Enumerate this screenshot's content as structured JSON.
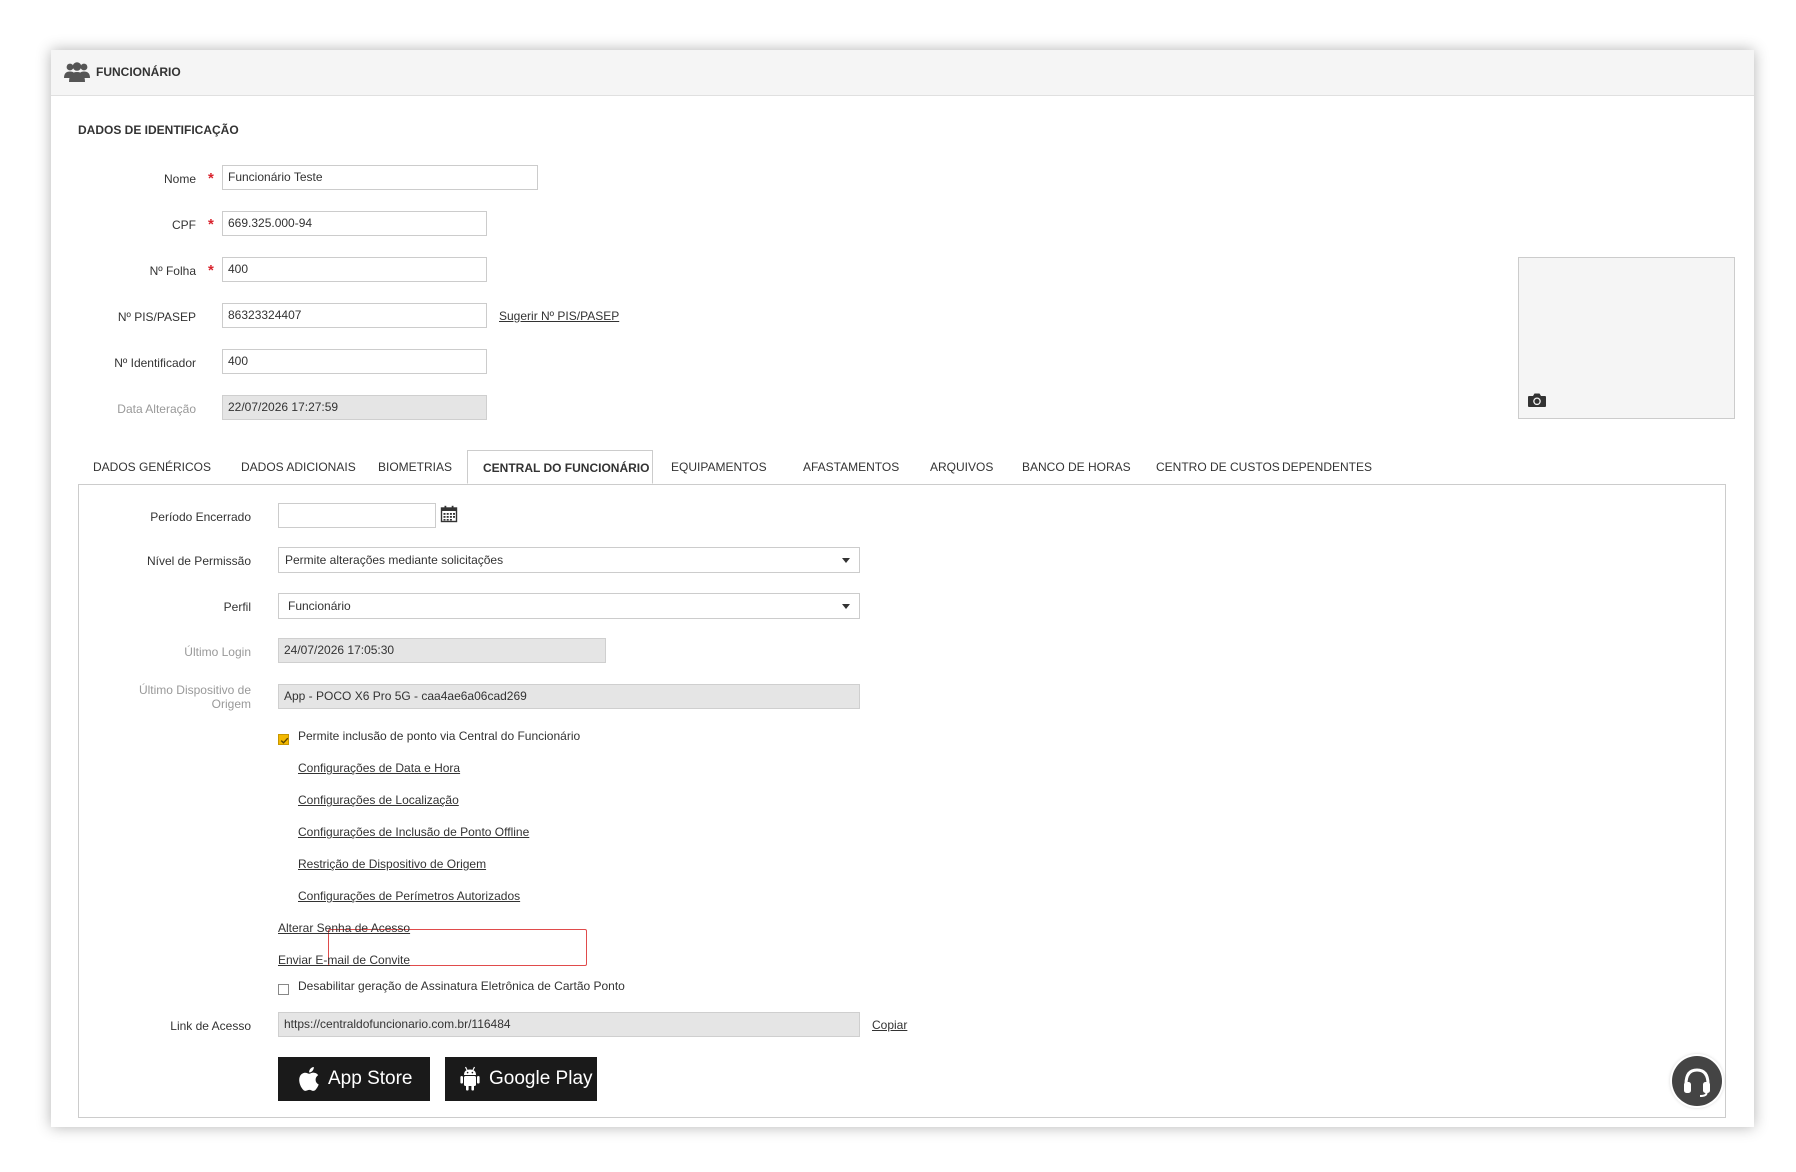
{
  "header": {
    "title": "FUNCIONÁRIO",
    "icon": "users-icon"
  },
  "identificacao": {
    "section_title": "DADOS DE IDENTIFICAÇÃO",
    "nome_label": "Nome",
    "nome_value": "Funcionário Teste",
    "cpf_label": "CPF",
    "cpf_value": "669.325.000-94",
    "folha_label": "Nº Folha",
    "folha_value": "400",
    "pis_label": "Nº PIS/PASEP",
    "pis_value": "86323324407",
    "pis_suggest": "Sugerir Nº PIS/PASEP",
    "identificador_label": "Nº Identificador",
    "identificador_value": "400",
    "data_alteracao_label": "Data Alteração",
    "data_alteracao_value": "22/07/2026 17:27:59",
    "required_mark": "*"
  },
  "tabs": [
    {
      "label": "DADOS GENÉRICOS"
    },
    {
      "label": "DADOS ADICIONAIS"
    },
    {
      "label": "BIOMETRIAS"
    },
    {
      "label": "CENTRAL DO FUNCIONÁRIO",
      "active": true
    },
    {
      "label": "EQUIPAMENTOS"
    },
    {
      "label": "AFASTAMENTOS"
    },
    {
      "label": "ARQUIVOS"
    },
    {
      "label": "BANCO DE HORAS"
    },
    {
      "label": "CENTRO DE CUSTOS"
    },
    {
      "label": "DEPENDENTES"
    }
  ],
  "central": {
    "periodo_label": "Período Encerrado",
    "periodo_value": "",
    "nivel_label": "Nível de Permissão",
    "nivel_value": "Permite alterações mediante solicitações",
    "perfil_label": "Perfil",
    "perfil_value": "Funcionário",
    "ultimo_login_label": "Último Login",
    "ultimo_login_value": "24/07/2026 17:05:30",
    "ultimo_dispositivo_label_1": "Último Dispositivo de",
    "ultimo_dispositivo_label_2": "Origem",
    "ultimo_dispositivo_value": "App - POCO X6 Pro 5G - caa4ae6a06cad269",
    "permite_inclusao": "Permite inclusão de ponto via Central do Funcionário",
    "permite_inclusao_checked": true,
    "links": [
      "Configurações de Data e Hora",
      "Configurações de Localização",
      "Configurações de Inclusão de Ponto Offline",
      "Restrição de Dispositivo de Origem",
      "Configurações de Perímetros Autorizados"
    ],
    "alterar_senha": "Alterar Senha de Acesso",
    "enviar_email": "Enviar E-mail de Convite",
    "desabilitar_assinatura": "Desabilitar geração de Assinatura Eletrônica de Cartão Ponto",
    "desabilitar_checked": false,
    "link_acesso_label": "Link de Acesso",
    "link_acesso_value": "https://centraldofuncionario.com.br/116484",
    "copiar": "Copiar",
    "app_store": "App Store",
    "google_play": "Google Play"
  },
  "colors": {
    "required": "#d9232d",
    "checkbox": "#f3b800",
    "highlight": "#e04b4b"
  }
}
